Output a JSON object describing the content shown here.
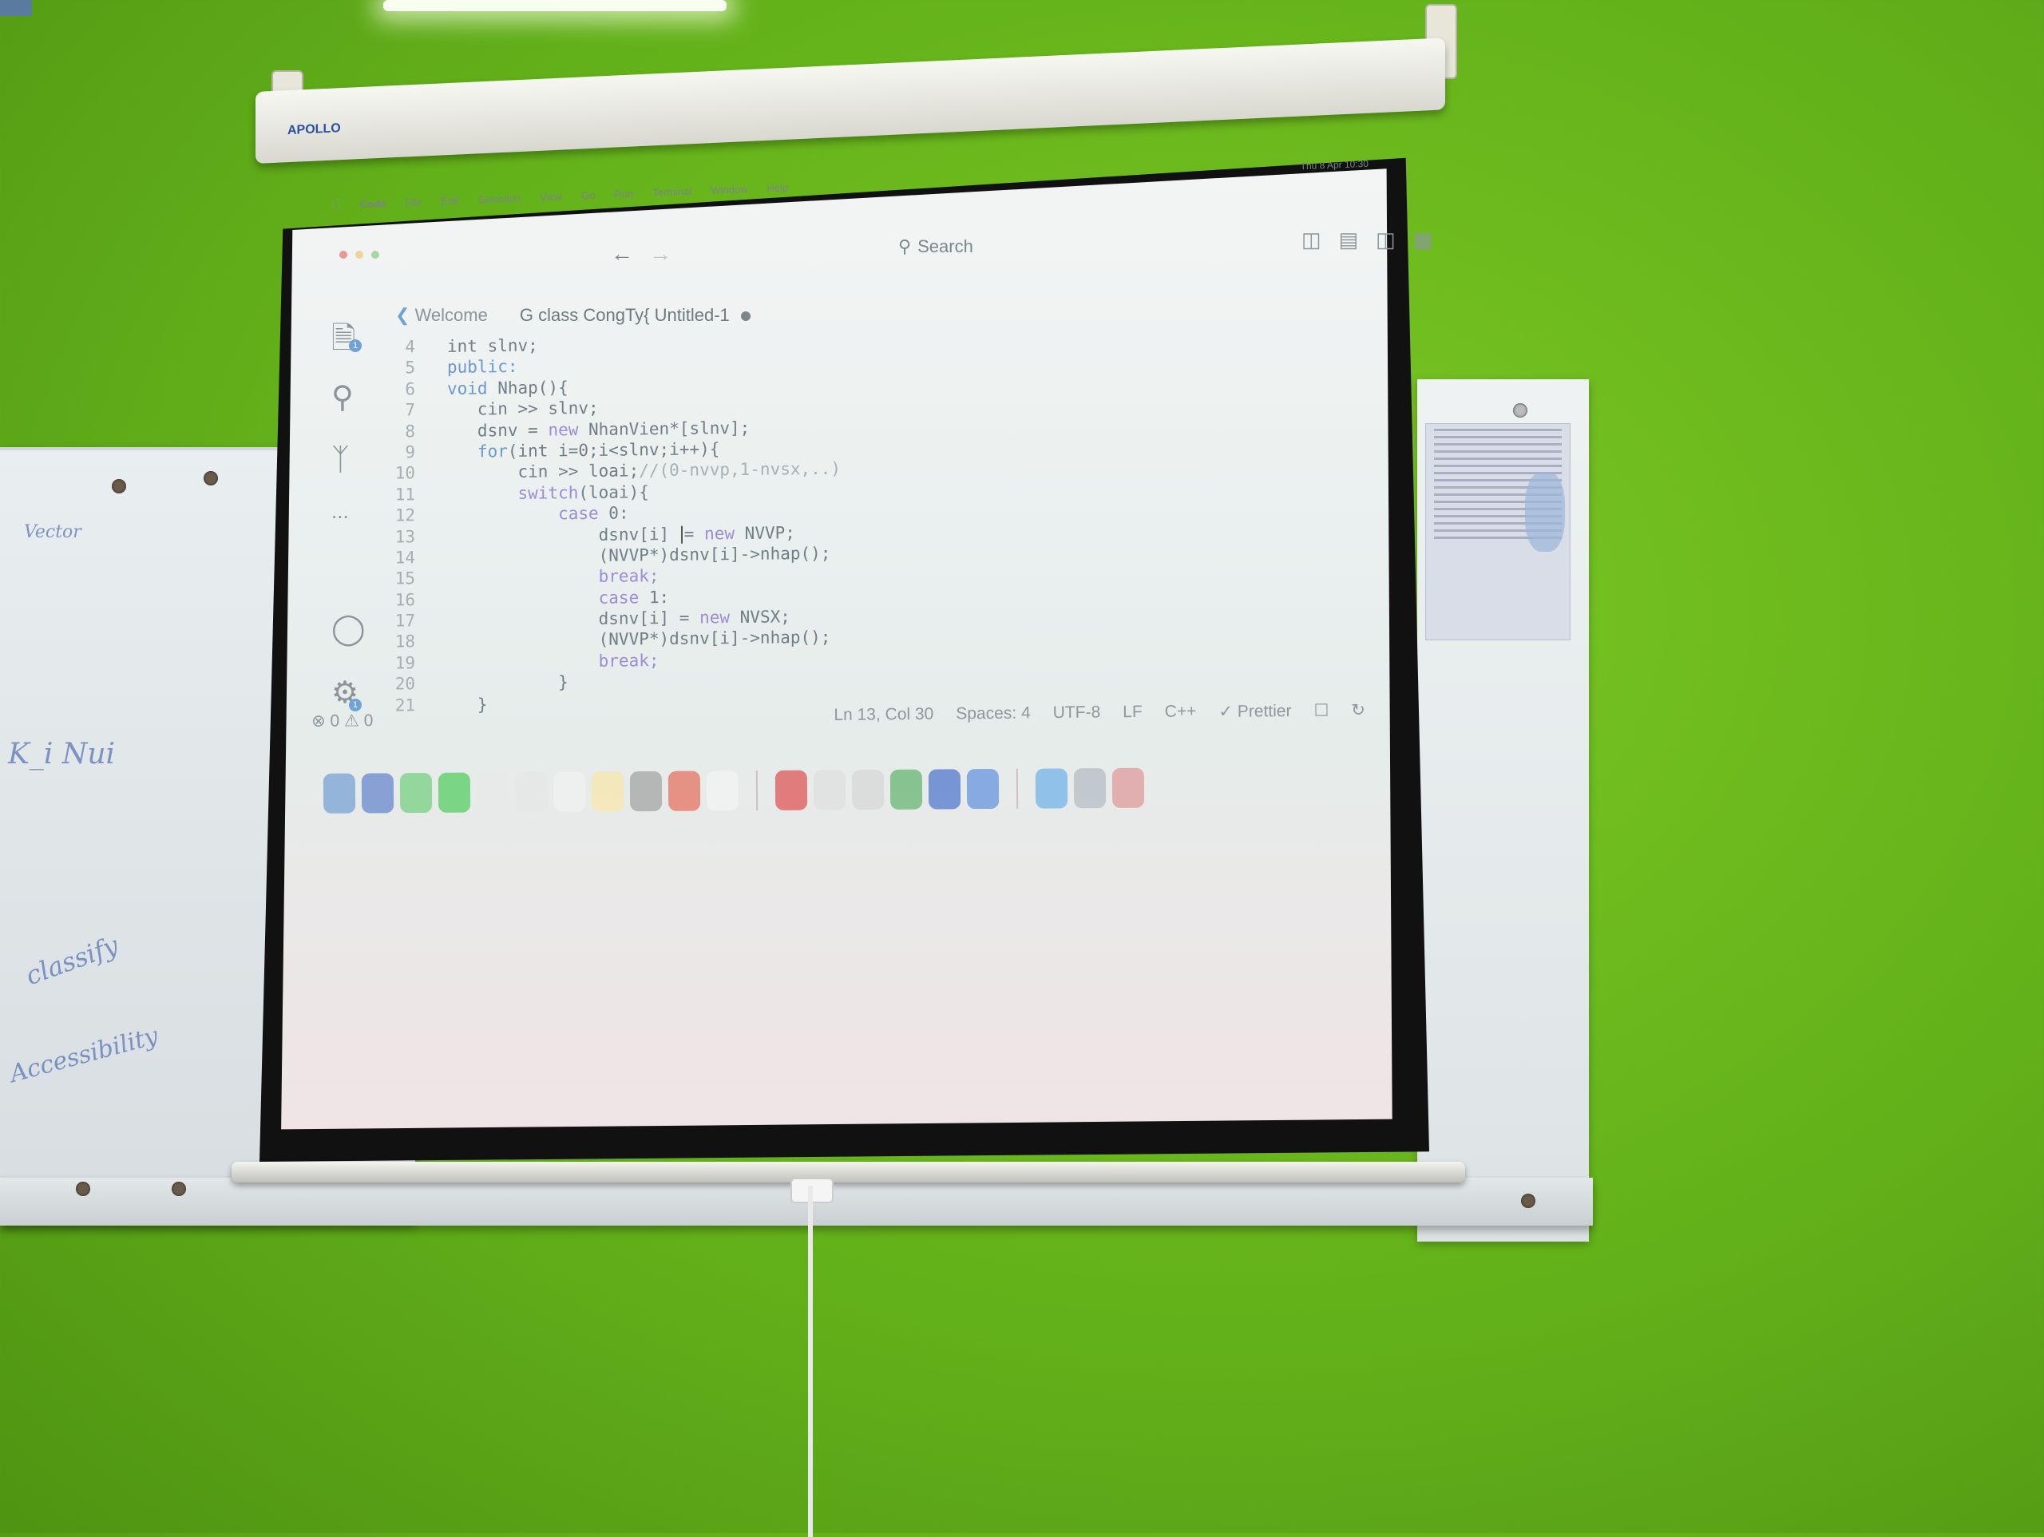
{
  "menubar": {
    "app_name": "Code",
    "items": [
      "File",
      "Edit",
      "Selection",
      "View",
      "Go",
      "Run",
      "Terminal",
      "Window",
      "Help"
    ],
    "clock": "Thu 8 Apr 10:30"
  },
  "titlebar": {
    "search_label": "Search",
    "back_arrow": "←",
    "forward_arrow": "→"
  },
  "tabs": [
    {
      "label": "Welcome",
      "icon": "vscode-icon"
    },
    {
      "label": "class CongTy{",
      "sublabel": "Untitled-1",
      "icon": "cpp-file-icon",
      "modified": true
    }
  ],
  "activity_bar": {
    "explorer_badge": "1",
    "settings_badge": "1",
    "more_label": "..."
  },
  "editor": {
    "lines": [
      {
        "n": "4",
        "parts": [
          [
            "code",
            "int slnv;"
          ]
        ]
      },
      {
        "n": "5",
        "parts": [
          [
            "kw2",
            "public:"
          ]
        ]
      },
      {
        "n": "6",
        "parts": [
          [
            "kw2",
            "void "
          ],
          [
            "code",
            "Nhap(){"
          ]
        ]
      },
      {
        "n": "7",
        "parts": [
          [
            "code",
            "   cin >> slnv;"
          ]
        ]
      },
      {
        "n": "8",
        "parts": [
          [
            "code",
            "   dsnv = "
          ],
          [
            "kw",
            "new "
          ],
          [
            "code",
            "NhanVien*[slnv];"
          ]
        ]
      },
      {
        "n": "9",
        "parts": [
          [
            "kw2",
            "   for"
          ],
          [
            "code",
            "(int i=0;i<slnv;i++){"
          ]
        ]
      },
      {
        "n": "10",
        "parts": [
          [
            "code",
            "       cin >> loai;"
          ],
          [
            "cm",
            "//(0-nvvp,1-nvsx,..)"
          ]
        ]
      },
      {
        "n": "11",
        "parts": [
          [
            "kw",
            "       switch"
          ],
          [
            "code",
            "(loai){"
          ]
        ]
      },
      {
        "n": "12",
        "parts": [
          [
            "kw",
            "           case "
          ],
          [
            "code",
            "0:"
          ]
        ]
      },
      {
        "n": "13",
        "parts": [
          [
            "code",
            "               dsnv[i] "
          ],
          [
            "cursor",
            "="
          ],
          [
            "kw",
            " new "
          ],
          [
            "code",
            "NVVP;"
          ]
        ]
      },
      {
        "n": "14",
        "parts": [
          [
            "code",
            "               (NVVP*)dsnv[i]->nhap();"
          ]
        ]
      },
      {
        "n": "15",
        "parts": [
          [
            "kw",
            "               break;"
          ]
        ]
      },
      {
        "n": "16",
        "parts": [
          [
            "kw",
            "               case "
          ],
          [
            "code",
            "1:"
          ]
        ]
      },
      {
        "n": "17",
        "parts": [
          [
            "code",
            "               dsnv[i] = "
          ],
          [
            "kw",
            "new "
          ],
          [
            "code",
            "NVSX;"
          ]
        ]
      },
      {
        "n": "18",
        "parts": [
          [
            "code",
            "               (NVVP*)dsnv[i]->nhap();"
          ]
        ]
      },
      {
        "n": "19",
        "parts": [
          [
            "kw",
            "               break;"
          ]
        ]
      },
      {
        "n": "20",
        "parts": [
          [
            "code",
            "           }"
          ]
        ]
      },
      {
        "n": "21",
        "parts": [
          [
            "code",
            "   }"
          ]
        ]
      }
    ]
  },
  "statusbar": {
    "problems": "⊗ 0 ⚠ 0",
    "position": "Ln 13, Col 30",
    "spaces": "Spaces: 4",
    "encoding": "UTF-8",
    "eol": "LF",
    "language": "C++",
    "formatter": "✓ Prettier"
  },
  "dock": {
    "colors": [
      "#7fa6d6",
      "#6f8fd0",
      "#7ed28a",
      "#5fcf6a",
      "#e9e9e9",
      "#e6e6e6",
      "#f0f0f0",
      "#f6e7b0",
      "#a9a9a9",
      "#e57a6a",
      "#f2f2f2",
      "sep",
      "#e06060",
      "#e0e0e0",
      "#d8d8d8",
      "#6fb97a",
      "#5b7fd0",
      "#6d9be0",
      "sep",
      "#7ab6e8",
      "#b8c0c8",
      "#e0a0a0"
    ]
  },
  "projector": {
    "brand": "APOLLO"
  },
  "whiteboard": {
    "scribbles": [
      "Vector",
      "K_i  Nui",
      "classify",
      "Accessibility"
    ]
  }
}
